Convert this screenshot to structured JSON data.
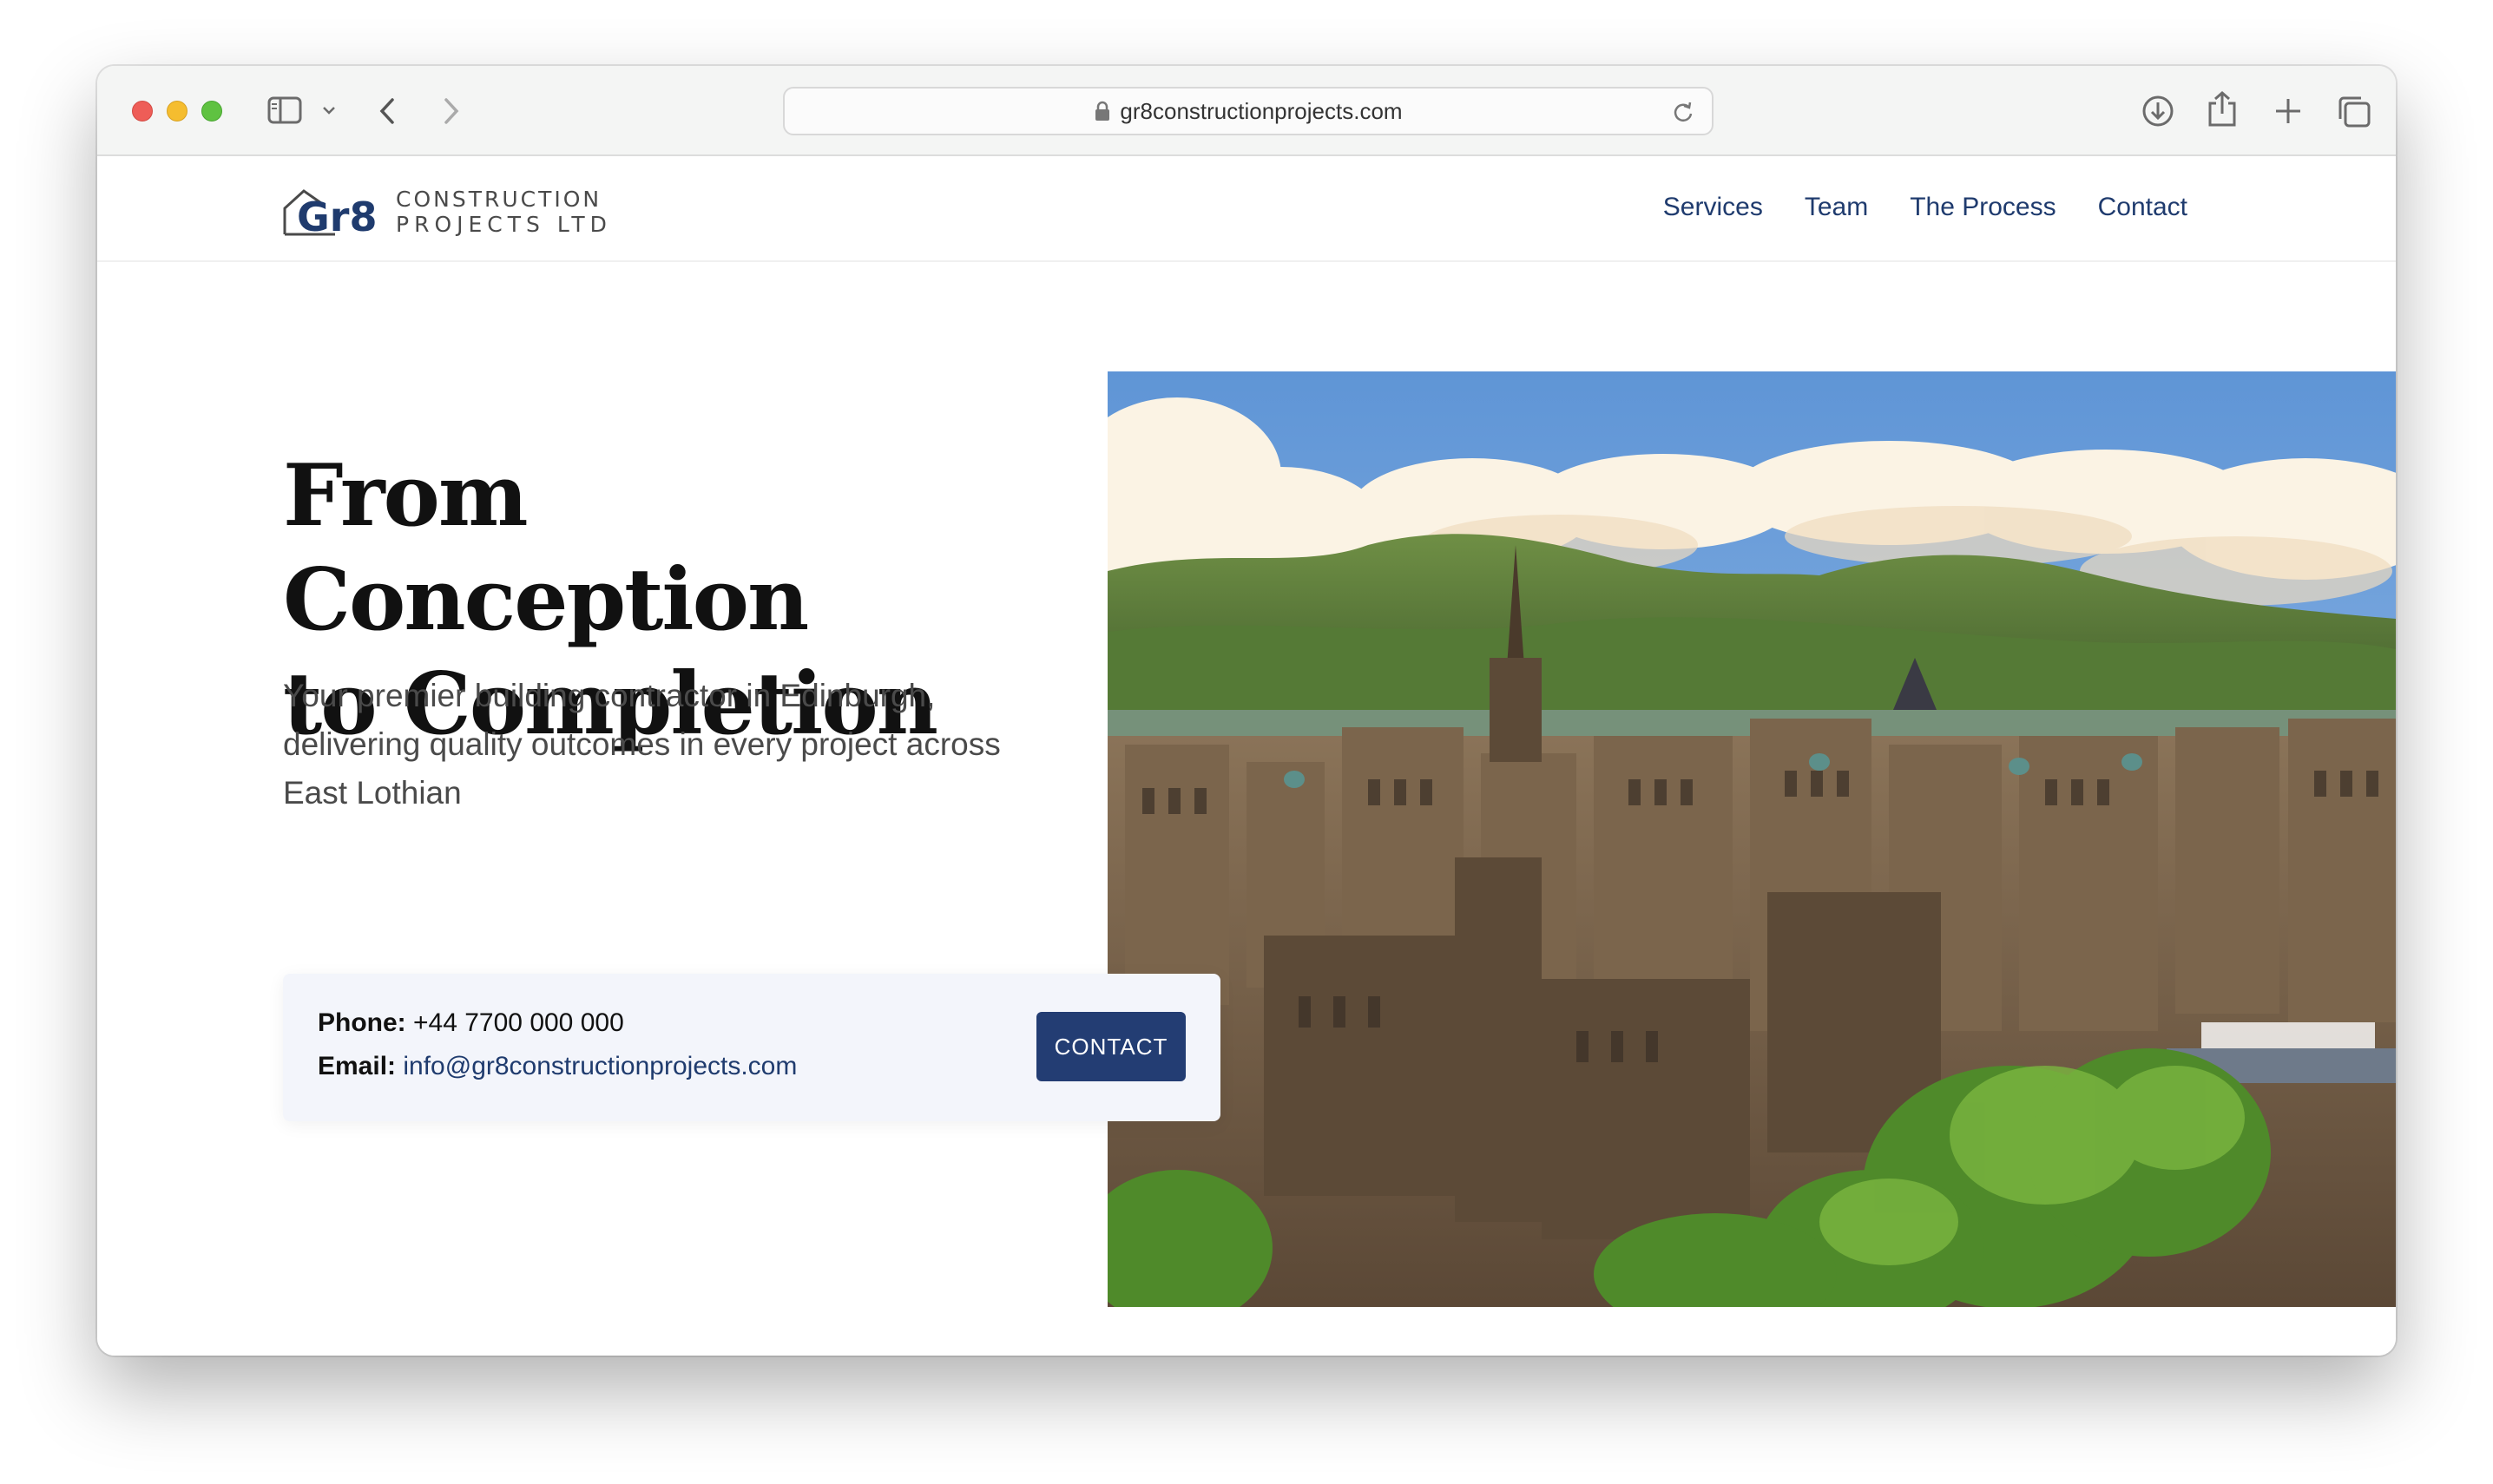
{
  "browser": {
    "url": "gr8constructionprojects.com"
  },
  "site": {
    "logo": {
      "mark": "Gr8",
      "line1": "CONSTRUCTION",
      "line2": "PROJECTS LTD"
    },
    "nav": [
      "Services",
      "Team",
      "The Process",
      "Contact"
    ]
  },
  "hero": {
    "title_line1": "From Conception",
    "title_line2": "to Completion",
    "subtitle_line1": "Your premier building contractor in Edinburgh,",
    "subtitle_line2": "delivering quality outcomes in every project across",
    "subtitle_line3": "East Lothian",
    "contact": {
      "phone_label": "Phone:",
      "phone": "+44 7700 000 000",
      "email_label": "Email:",
      "email": "info@gr8constructionprojects.com",
      "button": "CONTACT"
    }
  },
  "colors": {
    "brand": "#1f3b6e",
    "button": "#233d73",
    "contact_bg": "#f3f5fb"
  },
  "icons": {
    "sidebar": "sidebar-icon",
    "back": "chevron-left-icon",
    "forward": "chevron-right-icon",
    "lock": "lock-icon",
    "reload": "reload-icon",
    "download": "download-icon",
    "share": "share-icon",
    "new_tab": "plus-icon",
    "tabs": "tabs-overview-icon"
  }
}
